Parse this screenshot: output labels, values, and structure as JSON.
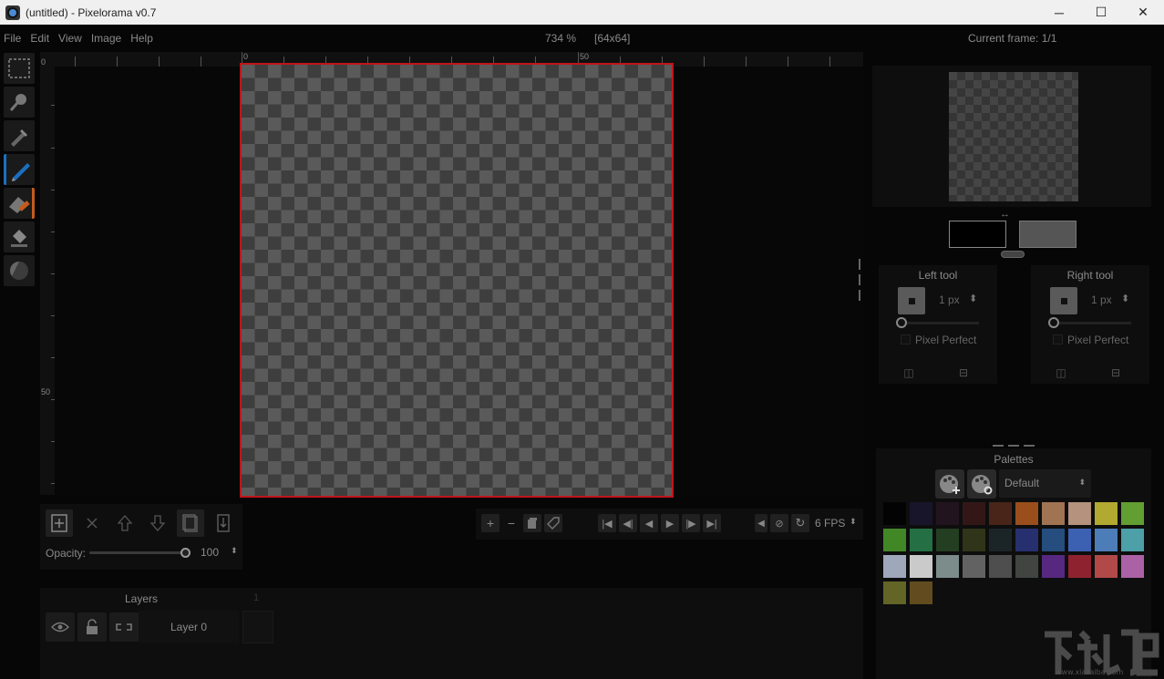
{
  "window": {
    "title": "(untitled) - Pixelorama v0.7",
    "minimize": "─",
    "maximize": "☐",
    "close": "✕"
  },
  "menu": {
    "items": [
      "File",
      "Edit",
      "View",
      "Image",
      "Help"
    ]
  },
  "status": {
    "zoom": "734 %",
    "canvas_size": "[64x64]",
    "current_frame": "Current frame: 1/1"
  },
  "ruler": {
    "top_labels": [
      "0",
      "50"
    ],
    "left_labels": [
      "0",
      "50"
    ]
  },
  "tools": [
    "rectangle-select",
    "zoom",
    "color-picker",
    "pencil",
    "eraser",
    "bucket",
    "lighten-darken"
  ],
  "layer_toolbar": {
    "opacity_label": "Opacity:",
    "opacity_value": "100",
    "opacity_fraction": 1.0
  },
  "timeline": {
    "fps": "6 FPS"
  },
  "layers": {
    "title": "Layers",
    "frame_number": "1",
    "rows": [
      {
        "name": "Layer 0"
      }
    ]
  },
  "colors": {
    "left": "#000000",
    "right": "#555555",
    "selection_border": "#c0141b"
  },
  "left_tool": {
    "title": "Left tool",
    "size": "1 px",
    "pixel_perfect": "Pixel Perfect"
  },
  "right_tool": {
    "title": "Right tool",
    "size": "1 px",
    "pixel_perfect": "Pixel Perfect"
  },
  "palettes": {
    "title": "Palettes",
    "selected": "Default",
    "swatches": [
      "#000000",
      "#1b1733",
      "#281624",
      "#3d1a1a",
      "#5a2b1c",
      "#c26020",
      "#c99067",
      "#e3b79c",
      "#e0d53a",
      "#7ac63c",
      "#4fa92b",
      "#2a8a52",
      "#2a4b26",
      "#3a3f1b",
      "#1f2c2e",
      "#2d3a8a",
      "#2c5f9c",
      "#4a78e0",
      "#5f9ce8",
      "#5fc8d4",
      "#c8d2ec",
      "#ffffff",
      "#9bb0ae",
      "#7a7a7a",
      "#606060",
      "#4f5550",
      "#6b2fa0",
      "#b42838",
      "#e05a5a",
      "#d77ad0",
      "#7a7d2c",
      "#7a5e24"
    ]
  },
  "watermark": {
    "site": "www.xiazaiba.com"
  }
}
